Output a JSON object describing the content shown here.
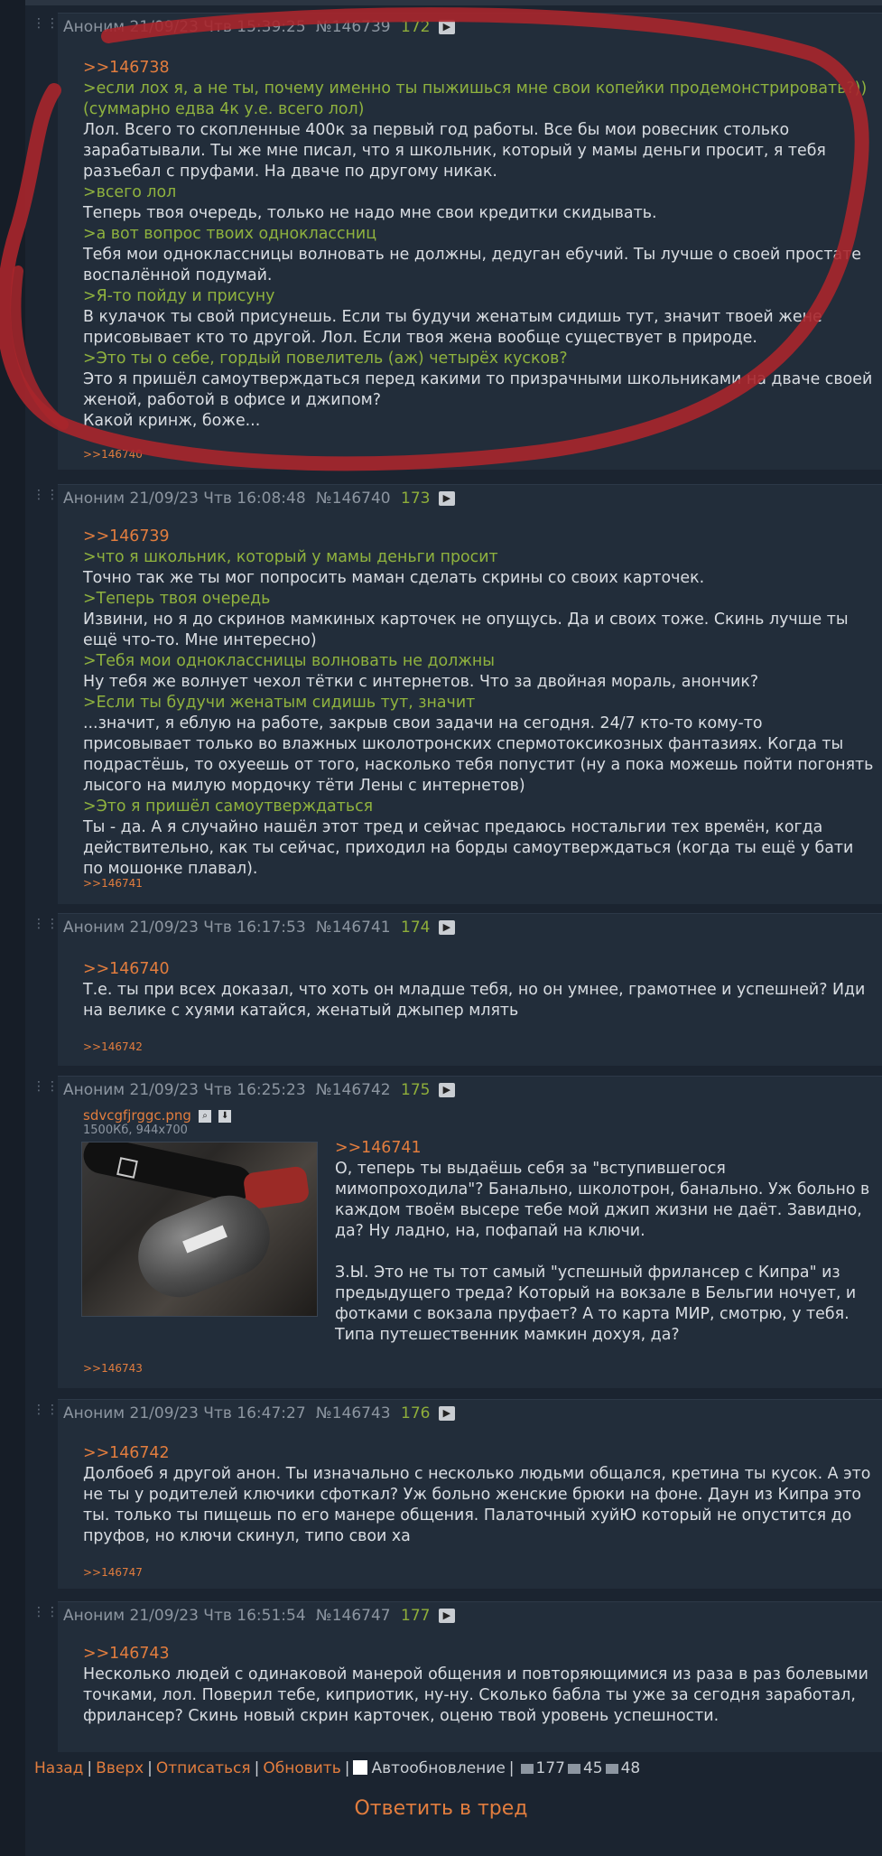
{
  "posts": [
    {
      "author": "Аноним",
      "date": "21/09/23 Чтв 15:39:25",
      "num": "№146739",
      "idx": "172",
      "lines": [
        {
          "t": "reply",
          "text": ">>146738"
        },
        {
          "t": "quote",
          "text": ">если лох я, а не ты, почему именно ты пыжишься мне свои копейки продемонстрировать?))"
        },
        {
          "t": "quote",
          "text": "(суммарно едва 4к у.е. всего лол)"
        },
        {
          "t": "text",
          "text": "Лол. Всего то скопленные 400к за первый год работы. Все бы мои ровесник столько зарабатывали. Ты же мне писал, что я школьник, который у мамы деньги просит, я тебя разъебал с пруфами. На дваче по другому никак."
        },
        {
          "t": "quote",
          "text": ">всего лол"
        },
        {
          "t": "text",
          "text": "Теперь твоя очередь, только не надо мне свои кредитки скидывать."
        },
        {
          "t": "quote",
          "text": ">а вот вопрос твоих одноклассниц"
        },
        {
          "t": "text",
          "text": "Тебя мои одноклассницы волновать не должны, дедуган ебучий. Ты лучше о своей простате воспалённой подумай."
        },
        {
          "t": "quote",
          "text": ">Я-то пойду и присуну"
        },
        {
          "t": "text",
          "text": "В кулачок ты свой присунешь. Если ты будучи женатым сидишь тут, значит твоей жене присовывает кто то другой. Лол. Если твоя жена вообще существует в природе."
        },
        {
          "t": "quote",
          "text": ">Это ты о себе, гордый повелитель (аж) четырёх кусков?"
        },
        {
          "t": "text",
          "text": "Это я пришёл самоутверждаться перед какими то призрачными школьниками на дваче своей женой, работой в офисе и джипом?"
        },
        {
          "t": "text",
          "text": "Какой кринж, боже..."
        }
      ],
      "backlink": ">>146740"
    },
    {
      "author": "Аноним",
      "date": "21/09/23 Чтв 16:08:48",
      "num": "№146740",
      "idx": "173",
      "lines": [
        {
          "t": "reply",
          "text": ">>146739"
        },
        {
          "t": "quote",
          "text": ">что я школьник, который у мамы деньги просит"
        },
        {
          "t": "text",
          "text": "Точно так же ты мог попросить маман сделать скрины со своих карточек."
        },
        {
          "t": "quote",
          "text": ">Теперь твоя очередь"
        },
        {
          "t": "text",
          "text": "Извини, но я до скринов мамкиных карточек не опущусь. Да и своих тоже. Скинь лучше ты ещё что-то. Мне интересно)"
        },
        {
          "t": "quote",
          "text": ">Тебя мои одноклассницы волновать не должны"
        },
        {
          "t": "text",
          "text": "Ну тебя же волнует чехол тётки с интернетов. Что за двойная мораль, анончик?"
        },
        {
          "t": "quote",
          "text": ">Если ты будучи женатым сидишь тут, значит"
        },
        {
          "t": "text",
          "text": "...значит, я еблую на работе, закрыв свои задачи на сегодня. 24/7 кто-то кому-то присовывает только во влажных школотронских спермотоксикозных фантазиях. Когда ты подрастёшь, то охуеешь от того, насколько тебя попустит (ну а пока можешь пойти погонять лысого на милую мордочку тёти Лены с интернетов)"
        },
        {
          "t": "quote",
          "text": ">Это я пришёл самоутверждаться"
        },
        {
          "t": "text",
          "text": "Ты - да. А я случайно нашёл этот тред и сейчас предаюсь ностальгии тех времён, когда действительно, как ты сейчас, приходил на борды самоутверждаться (когда ты ещё у бати по мошонке плавал)."
        }
      ],
      "backlink": ">>146741"
    },
    {
      "author": "Аноним",
      "date": "21/09/23 Чтв 16:17:53",
      "num": "№146741",
      "idx": "174",
      "lines": [
        {
          "t": "reply",
          "text": ">>146740"
        },
        {
          "t": "text",
          "text": "Т.е. ты при всех доказал, что хоть он младше тебя, но он умнее, грамотнее и успешней? Иди на велике с хуями катайся, женатый джыпер млять"
        }
      ],
      "backlink": ">>146742"
    },
    {
      "author": "Аноним",
      "date": "21/09/23 Чтв 16:25:23",
      "num": "№146742",
      "idx": "175",
      "file": {
        "name": "sdvcgfjrggc.png",
        "meta": "1500Кб, 944x700"
      },
      "lines": [
        {
          "t": "reply",
          "text": ">>146741"
        },
        {
          "t": "text",
          "text": "О, теперь ты выдаёшь себя за \"вступившегося мимопроходила\"? Банально, школотрон, банально. Уж больно в каждом твоём высере тебе мой джип жизни не даёт. Завидно, да? Ну ладно, на, пофапай на ключи."
        },
        {
          "t": "blank",
          "text": ""
        },
        {
          "t": "text",
          "text": "З.Ы. Это не ты тот самый \"успешный фрилансер с Кипра\" из предыдущего треда? Который на вокзале в Бельгии ночует, и фотками с вокзала пруфает? А то карта МИР, смотрю, у тебя. Типа путешественник мамкин дохуя, да?"
        }
      ],
      "backlink": ">>146743"
    },
    {
      "author": "Аноним",
      "date": "21/09/23 Чтв 16:47:27",
      "num": "№146743",
      "idx": "176",
      "lines": [
        {
          "t": "reply",
          "text": ">>146742"
        },
        {
          "t": "text",
          "text": "Долбоеб я другой анон. Ты изначально с несколько людьми общался, кретина ты кусок. А это не ты у родителей ключики сфоткал? Уж больно женские брюки на фоне. Даун из Кипра это ты. только ты пищешь по его манере общения. Палаточный хуйЮ который не опустится до пруфов, но ключи скинул, типо свои ха"
        }
      ],
      "backlink": ">>146747"
    },
    {
      "author": "Аноним",
      "date": "21/09/23 Чтв 16:51:54",
      "num": "№146747",
      "idx": "177",
      "lines": [
        {
          "t": "reply",
          "text": ">>146743"
        },
        {
          "t": "text",
          "text": "Несколько людей с одинаковой манерой общения и повторяющимися из раза в раз болевыми точками, лол. Поверил тебе, киприотик, ну-ну. Сколько бабла ты уже за сегодня заработал, фрилансер? Скинь новый скрин карточек, оценю твой уровень успешности."
        }
      ],
      "backlink": ""
    }
  ],
  "footer": {
    "back": "Назад",
    "up": "Вверх",
    "unsubscribe": "Отписаться",
    "refresh": "Обновить",
    "autoupdate": "Автообновление",
    "posts_count": "177",
    "files_count": "45",
    "users_count": "48"
  },
  "answer_label": "Ответить в тред"
}
